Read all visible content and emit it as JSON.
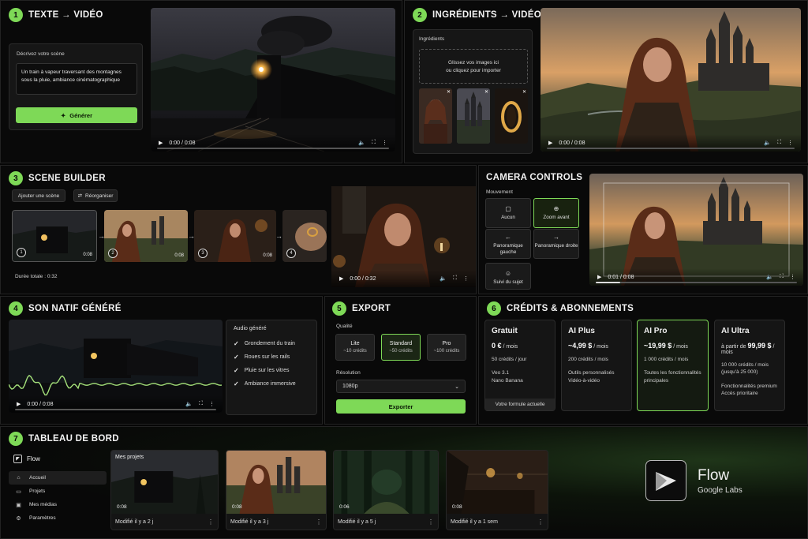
{
  "s1": {
    "num": "1",
    "title": "TEXTE → VIDÉO",
    "prompt_label": "Décrivez votre scène",
    "prompt_value": "Un train à vapeur traversant des montagnes sous la pluie, ambiance cinématographique",
    "generate": "Générer",
    "time": "0:00 / 0:08",
    "progress": 0.0
  },
  "s2": {
    "num": "2",
    "title": "INGRÉDIENTS → VIDÉO",
    "ingredients_label": "Ingrédients",
    "drop_line1": "Glissez vos images ici",
    "drop_line2": "ou cliquez pour importer",
    "time": "0:00 / 0:08",
    "progress": 0.0
  },
  "s3": {
    "num": "3",
    "title": "SCENE BUILDER",
    "add_scene": "Ajouter une scène",
    "reorganize": "Réorganiser",
    "scenes": [
      {
        "n": "1",
        "dur": "0:08"
      },
      {
        "n": "2",
        "dur": "0:08"
      },
      {
        "n": "3",
        "dur": "0:08"
      },
      {
        "n": "4",
        "dur": ""
      }
    ],
    "total": "Durée totale : 0:32",
    "time": "0:00 / 0:32",
    "progress": 0.0
  },
  "cam": {
    "title": "CAMERA CONTROLS",
    "movement_label": "Mouvement",
    "options": [
      {
        "label": "Aucun",
        "icon": "none-icon",
        "selected": false
      },
      {
        "label": "Zoom avant",
        "icon": "zoom-in-icon",
        "selected": true
      },
      {
        "label": "Panoramique gauche",
        "icon": "arrow-left-icon",
        "selected": false
      },
      {
        "label": "Panoramique droite",
        "icon": "arrow-right-icon",
        "selected": false
      },
      {
        "label": "Suivi du sujet",
        "icon": "person-icon",
        "selected": false
      }
    ],
    "time": "0:01 / 0:08",
    "progress": 0.12
  },
  "s4": {
    "num": "4",
    "title": "SON NATIF GÉNÉRÉ",
    "audio_label": "Audio généré",
    "items": [
      "Grondement du train",
      "Roues sur les rails",
      "Pluie sur les vitres",
      "Ambiance immersive"
    ],
    "time": "0:00 / 0:08",
    "progress": 0.0
  },
  "s5": {
    "num": "5",
    "title": "EXPORT",
    "quality_label": "Qualité",
    "qualities": [
      {
        "name": "Lite",
        "credits": "~10 crédits",
        "selected": false
      },
      {
        "name": "Standard",
        "credits": "~50 crédits",
        "selected": true
      },
      {
        "name": "Pro",
        "credits": "~100 crédits",
        "selected": false
      }
    ],
    "resolution_label": "Résolution",
    "resolution": "1080p",
    "export": "Exporter"
  },
  "s6": {
    "num": "6",
    "title": "CRÉDITS & ABONNEMENTS",
    "plans": [
      {
        "name": "Gratuit",
        "price": "0 €",
        "per": " / mois",
        "desc1": "50 crédits / jour",
        "desc2": "Veo 3.1",
        "desc3": "Nano Banana",
        "footer": "Votre formule actuelle"
      },
      {
        "name": "AI Plus",
        "price": "~4,99 $",
        "per": " / mois",
        "desc1": "200 crédits / mois",
        "desc2": "Outils personnalisés",
        "desc3": "Vidéo-à-vidéo",
        "footer": ""
      },
      {
        "name": "AI Pro",
        "price": "~19,99 $",
        "per": " / mois",
        "desc1": "1 000 crédits / mois",
        "desc2": "Toutes les fonctionnalités",
        "desc3": "principales",
        "footer": ""
      },
      {
        "name": "AI Ultra",
        "price_prefix": "à partir de ",
        "price": "99,99 $",
        "per": " / mois",
        "desc1": "10 000 crédits / mois",
        "desc1b": "(jusqu'à 25 000)",
        "desc2": "Fonctionnalités premium",
        "desc3": "Accès prioritaire",
        "footer": ""
      }
    ]
  },
  "s7": {
    "num": "7",
    "title": "TABLEAU DE BORD",
    "app": "Flow",
    "nav": [
      {
        "label": "Accueil",
        "icon": "home-icon",
        "active": true
      },
      {
        "label": "Projets",
        "icon": "folder-icon",
        "active": false
      },
      {
        "label": "Mes médias",
        "icon": "media-icon",
        "active": false
      },
      {
        "label": "Paramètres",
        "icon": "gear-icon",
        "active": false
      }
    ],
    "my_projects": "Mes projets",
    "projects": [
      {
        "dur": "0:08",
        "modified": "Modifié il y a 2 j"
      },
      {
        "dur": "0:08",
        "modified": "Modifié il y a 3 j"
      },
      {
        "dur": "0:06",
        "modified": "Modifié il y a 5 j"
      },
      {
        "dur": "0:08",
        "modified": "Modifié il y a 1 sem"
      }
    ],
    "brand_name": "Flow",
    "brand_sub": "Google Labs"
  },
  "colors": {
    "accent": "#7ed957",
    "bg": "#060606",
    "panel": "#0e0e0e"
  }
}
